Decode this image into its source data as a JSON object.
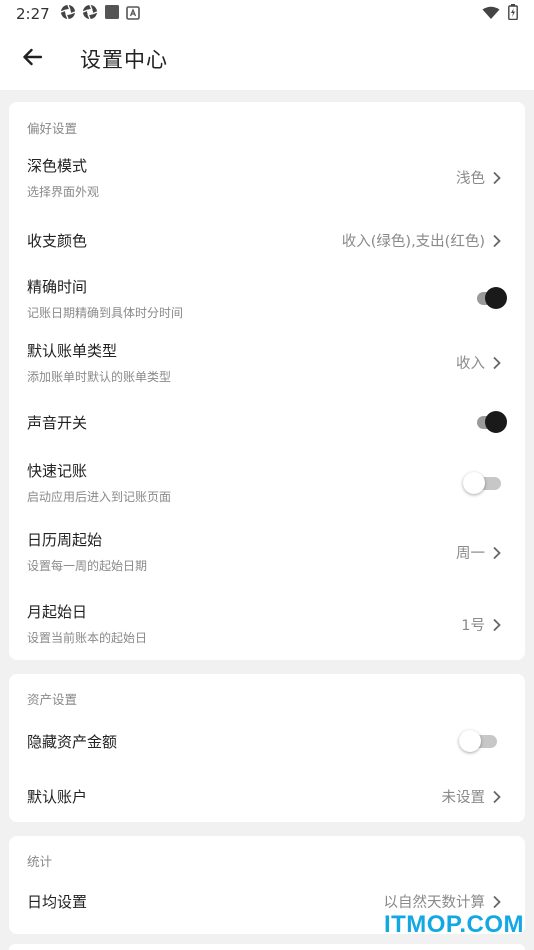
{
  "status_bar": {
    "time": "2:27",
    "icons": [
      "aperture-icon",
      "aperture-icon",
      "square-icon",
      "font-icon",
      "wifi-icon",
      "battery-charging-icon"
    ]
  },
  "app_bar": {
    "title": "设置中心",
    "back_icon": "arrow-left-icon"
  },
  "sections": {
    "preferences": {
      "title": "偏好设置",
      "dark_mode": {
        "label": "深色模式",
        "sub": "选择界面外观",
        "value": "浅色"
      },
      "color": {
        "label": "收支颜色",
        "value": "收入(绿色),支出(红色)"
      },
      "precise_time": {
        "label": "精确时间",
        "sub": "记账日期精确到具体时分时间",
        "on": true
      },
      "default_type": {
        "label": "默认账单类型",
        "sub": "添加账单时默认的账单类型",
        "value": "收入"
      },
      "sound": {
        "label": "声音开关",
        "on": true
      },
      "quick": {
        "label": "快速记账",
        "sub": "启动应用后进入到记账页面",
        "on": false
      },
      "week_start": {
        "label": "日历周起始",
        "sub": "设置每一周的起始日期",
        "value": "周一"
      },
      "month_start": {
        "label": "月起始日",
        "sub": "设置当前账本的起始日",
        "value": "1号"
      }
    },
    "assets": {
      "title": "资产设置",
      "hide_amount": {
        "label": "隐藏资产金额",
        "on": false
      },
      "default_account": {
        "label": "默认账户",
        "value": "未设置"
      }
    },
    "stats": {
      "title": "统计",
      "daily_avg": {
        "label": "日均设置",
        "value": "以自然天数计算"
      }
    }
  },
  "watermark": "ITMOP.COM",
  "colors": {
    "background": "#f1f1f1",
    "card": "#ffffff",
    "toggle_on": "#1a1a1a",
    "watermark": "#12a8e3"
  }
}
